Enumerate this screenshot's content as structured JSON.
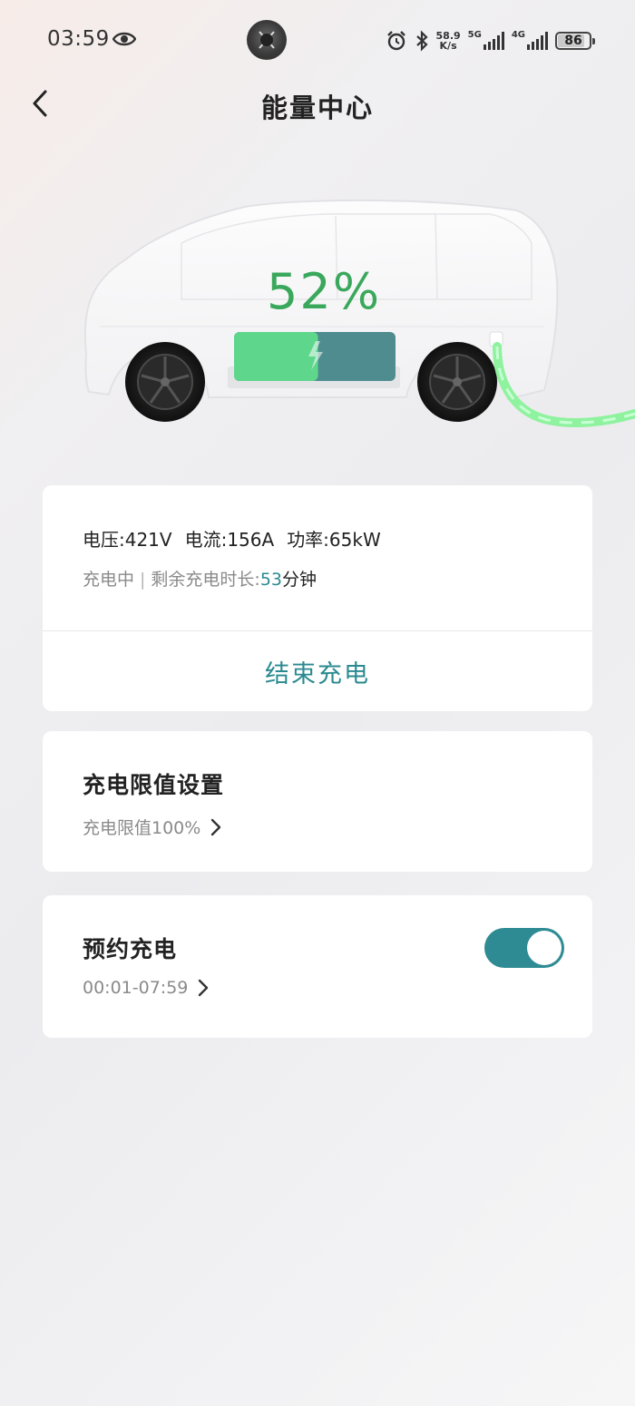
{
  "status_bar": {
    "time": "03:59",
    "net_speed_value": "58.9",
    "net_speed_unit": "K/s",
    "sim1_type": "5G",
    "sim2_type": "4G",
    "battery": "86",
    "battery_level": 0.86
  },
  "header": {
    "title": "能量中心"
  },
  "hero": {
    "charge_percent": "52%",
    "charge_level": 0.52,
    "colors": {
      "charged": "#5ed68c",
      "remaining": "#4e8c8f",
      "cable": "#8ef29f"
    }
  },
  "charging_card": {
    "voltage": "电压:421V",
    "current": "电流:156A",
    "power": "功率:65kW",
    "status": "充电中",
    "separator": "|",
    "remaining_label": "剩余充电时长:",
    "remaining_minutes": "53",
    "minutes_unit": "分钟",
    "end_button": "结束充电"
  },
  "limit_card": {
    "title": "充电限值设置",
    "value": "充电限值100%"
  },
  "schedule_card": {
    "title": "预约充电",
    "time_range": "00:01-07:59",
    "enabled": true
  },
  "theme": {
    "accent": "#2e8b93",
    "percent_green": "#3aa85c"
  }
}
